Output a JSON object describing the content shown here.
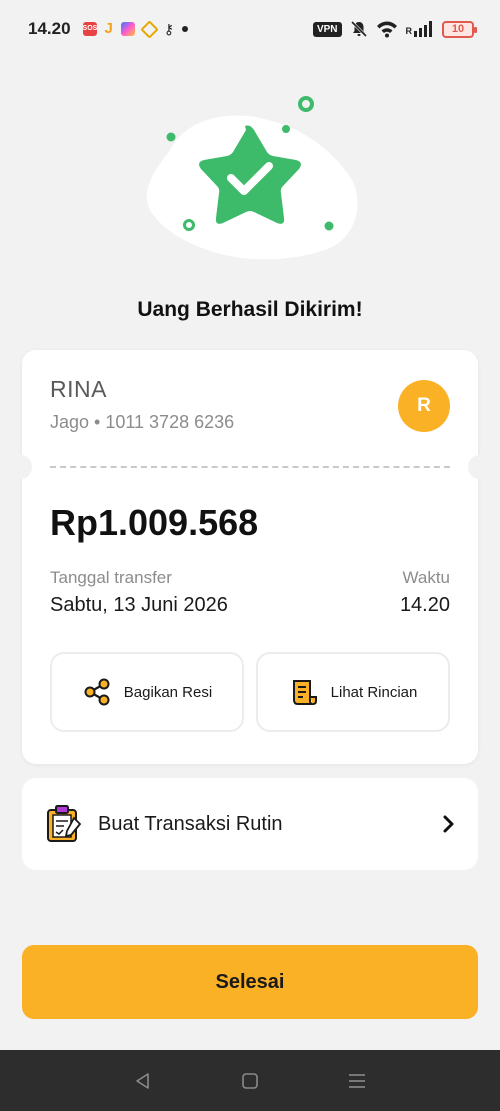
{
  "status_bar": {
    "time": "14.20",
    "vpn_label": "VPN",
    "battery_level": "10",
    "network_label": "R"
  },
  "hero": {
    "icon": "star-check-icon",
    "accent_color": "#3dbb6b",
    "title": "Uang Berhasil Dikirim!"
  },
  "recipient": {
    "name": "RINA",
    "account": "Jago • 1011 3728 6236",
    "avatar_initial": "R",
    "avatar_color": "#fbb125"
  },
  "transfer": {
    "amount": "Rp1.009.568",
    "date_label": "Tanggal transfer",
    "date_value": "Sabtu, 13 Juni 2026",
    "time_label": "Waktu",
    "time_value": "14.20"
  },
  "actions": {
    "share_label": "Bagikan Resi",
    "share_icon": "share-icon",
    "details_label": "Lihat Rincian",
    "details_icon": "receipt-icon"
  },
  "routine": {
    "label": "Buat Transaksi Rutin",
    "icon": "clipboard-icon"
  },
  "done_button": {
    "label": "Selesai",
    "color": "#fbb125"
  },
  "nav": {
    "back_icon": "back-icon",
    "home_icon": "home-icon",
    "menu_icon": "menu-icon"
  }
}
